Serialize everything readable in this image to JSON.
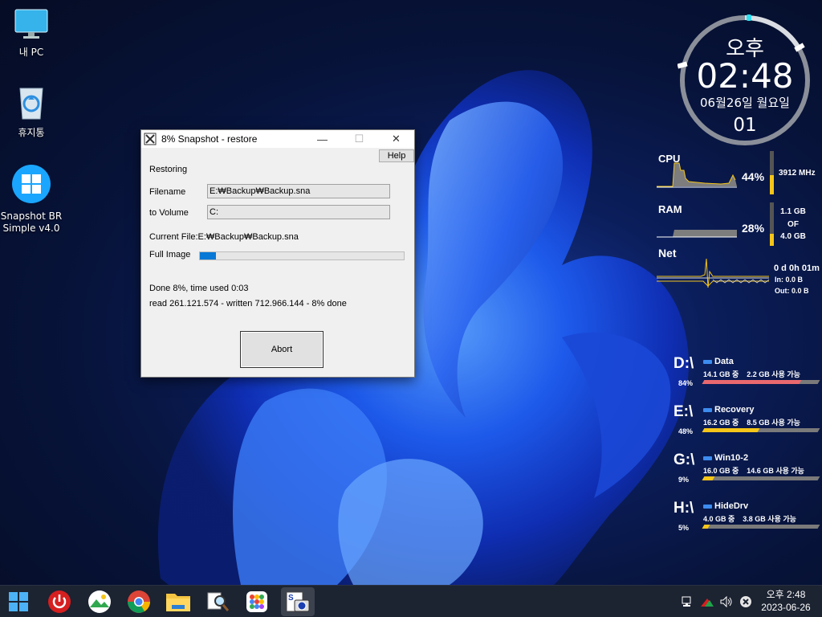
{
  "desktop": {
    "icons": [
      {
        "label": "내 PC",
        "icon": "monitor-icon"
      },
      {
        "label": "휴지통",
        "icon": "recycle-bin-icon"
      },
      {
        "label": "Snapshot BR",
        "label2": "Simple v4.0",
        "icon": "windows-logo-icon"
      }
    ]
  },
  "dialog": {
    "title": "8% Snapshot - restore",
    "help_label": "Help",
    "restoring_label": "Restoring",
    "filename_label": "Filename",
    "filename_value": "E:₩Backup₩Backup.sna",
    "volume_label": "to Volume",
    "volume_value": "C:",
    "current_file": "Current File:E:₩Backup₩Backup.sna",
    "full_image_label": "Full Image",
    "progress_fraction": 0.08,
    "done_text": "Done 8%, time used  0:03",
    "read_text": "read  261.121.574 - written  712.966.144 - 8% done",
    "abort_label": "Abort",
    "controls": {
      "minimize": "—",
      "maximize": "☐",
      "close": "✕"
    }
  },
  "clock": {
    "ampm": "오후",
    "time": "02:48",
    "date": "06월26일 월요일",
    "seconds": "01"
  },
  "monitor": {
    "cpu_label": "CPU",
    "cpu_pct": "44%",
    "cpu_freq": "3912 MHz",
    "cpu_fraction": 0.44,
    "ram_label": "RAM",
    "ram_pct": "28%",
    "ram_used": "1.1 GB",
    "ram_of": "OF",
    "ram_total": "4.0 GB",
    "ram_fraction": 0.28,
    "net_label": "Net",
    "net_uptime": "0 d 0h 01m",
    "net_in": "In: 0.0 B",
    "net_out": "Out: 0.0 B"
  },
  "drives": [
    {
      "letter": "D:\\",
      "name": "Data",
      "pct": "84%",
      "info": "14.1 GB 중    2.2 GB 사용 가능",
      "fraction": 0.84,
      "color": "#e8696f"
    },
    {
      "letter": "E:\\",
      "name": "Recovery",
      "pct": "48%",
      "info": "16.2 GB 중    8.5 GB 사용 가능",
      "fraction": 0.48,
      "color": "#f5c518"
    },
    {
      "letter": "G:\\",
      "name": "Win10-2",
      "pct": "9%",
      "info": "16.0 GB 중    14.6 GB 사용 가능",
      "fraction": 0.09,
      "color": "#f5c518"
    },
    {
      "letter": "H:\\",
      "name": "HideDrv",
      "pct": "5%",
      "info": "4.0 GB 중    3.8 GB 사용 가능",
      "fraction": 0.05,
      "color": "#f5c518"
    }
  ],
  "taskbar": {
    "icons": [
      "start-icon",
      "power-icon",
      "photos-icon",
      "chrome-icon",
      "file-explorer-icon",
      "search-tool-icon",
      "app-grid-icon",
      "snapshot-icon"
    ],
    "tray_time": "오후 2:48",
    "tray_date": "2023-06-26"
  }
}
